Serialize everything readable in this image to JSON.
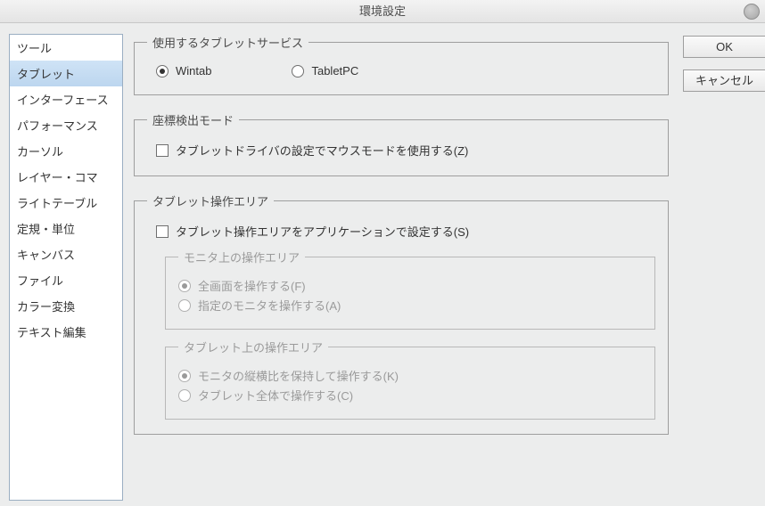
{
  "window": {
    "title": "環境設定"
  },
  "buttons": {
    "ok": "OK",
    "cancel": "キャンセル"
  },
  "sidebar": {
    "items": [
      "ツール",
      "タブレット",
      "インターフェース",
      "パフォーマンス",
      "カーソル",
      "レイヤー・コマ",
      "ライトテーブル",
      "定規・単位",
      "キャンバス",
      "ファイル",
      "カラー変換",
      "テキスト編集"
    ],
    "selected_index": 1
  },
  "groups": {
    "tablet_service": {
      "legend": "使用するタブレットサービス",
      "options": {
        "wintab": "Wintab",
        "tabletpc": "TabletPC"
      },
      "selected": "wintab"
    },
    "coord_mode": {
      "legend": "座標検出モード",
      "checkbox_label": "タブレットドライバの設定でマウスモードを使用する(Z)",
      "checked": false
    },
    "operation_area": {
      "legend": "タブレット操作エリア",
      "checkbox_label": "タブレット操作エリアをアプリケーションで設定する(S)",
      "checked": false,
      "monitor_area": {
        "legend": "モニタ上の操作エリア",
        "options": {
          "full": "全画面を操作する(F)",
          "specified": "指定のモニタを操作する(A)"
        },
        "selected": "full",
        "enabled": false
      },
      "tablet_area": {
        "legend": "タブレット上の操作エリア",
        "options": {
          "keep_ratio": "モニタの縦横比を保持して操作する(K)",
          "whole": "タブレット全体で操作する(C)"
        },
        "selected": "keep_ratio",
        "enabled": false
      }
    }
  }
}
